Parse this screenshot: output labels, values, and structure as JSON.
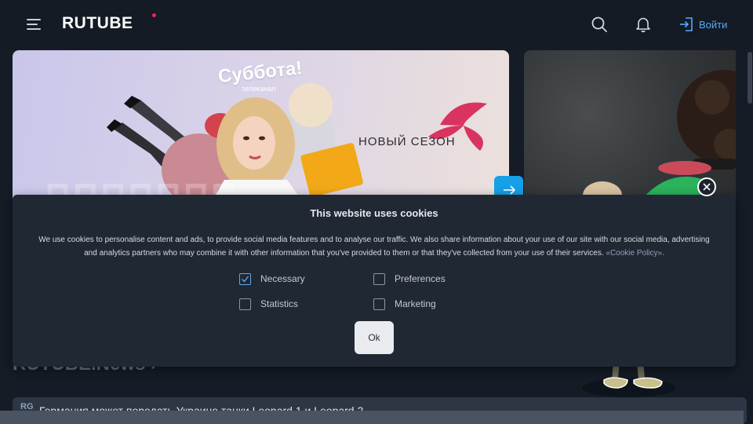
{
  "header": {
    "logo_text": "RUTUBE",
    "login_label": "Войти",
    "icons": {
      "menu": "hamburger-menu-icon",
      "search": "search-icon",
      "notifications": "bell-icon",
      "login": "login-icon"
    },
    "colors": {
      "brand_dot": "#ff1f4b",
      "login_blue": "#57a7ff"
    }
  },
  "hero": {
    "promo_title": "Суббота!",
    "promo_subtitle": "телеканал",
    "promo_season": "НОВЫЙ СЕЗОН",
    "next_icon": "arrow-right-icon",
    "next_color": "#16a0e8"
  },
  "cookie_banner": {
    "title": "This website uses cookies",
    "text": "We use cookies to personalise content and ads, to provide social media features and to analyse our traffic. We also share information about your use of our site with our social media, advertising and analytics partners who may combine it with other information that you've provided to them or that they've collected from your use of their services.",
    "policy_link": "«Cookie Policy».",
    "options": [
      {
        "label": "Necessary",
        "checked": true
      },
      {
        "label": "Preferences",
        "checked": false
      },
      {
        "label": "Statistics",
        "checked": false
      },
      {
        "label": "Marketing",
        "checked": false
      }
    ],
    "ok_label": "Ok",
    "close_icon": "close-icon"
  },
  "news": {
    "section_title": "RUTUBE.News",
    "chevron": "›",
    "items": [
      {
        "source": "RG",
        "text": "Германия может передать Украине танки Leopard 1 и Leopard 2"
      }
    ]
  }
}
